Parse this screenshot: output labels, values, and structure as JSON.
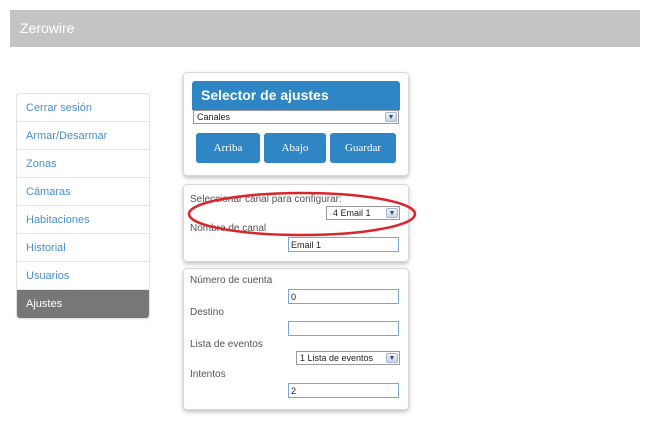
{
  "header": {
    "title": "Zerowire"
  },
  "sidebar": {
    "items": [
      {
        "label": "Cerrar sesión"
      },
      {
        "label": "Armar/Desarmar"
      },
      {
        "label": "Zonas"
      },
      {
        "label": "Cámaras"
      },
      {
        "label": "Habitaciones"
      },
      {
        "label": "Historial"
      },
      {
        "label": "Usuarios"
      },
      {
        "label": "Ajustes"
      }
    ],
    "active_index": 7
  },
  "selector": {
    "title": "Selector de ajustes",
    "selected": "Canales",
    "buttons": {
      "up": "Arriba",
      "down": "Abajo",
      "save": "Guardar"
    }
  },
  "channel": {
    "select_label": "Seleccionar canal para configurar:",
    "select_value": "4 Email 1",
    "name_label": "Nombre de canal",
    "name_value": "Email 1"
  },
  "account": {
    "number_label": "Número de cuenta",
    "number_value": "0",
    "destination_label": "Destino",
    "destination_value": "",
    "events_label": "Lista de eventos",
    "events_value": "1 Lista de eventos",
    "attempts_label": "Intentos",
    "attempts_value": "2"
  },
  "colors": {
    "accent": "#2f86c4",
    "header_bg": "#c4c4c4",
    "sidebar_active": "#777777",
    "annotation": "#d9262c"
  }
}
